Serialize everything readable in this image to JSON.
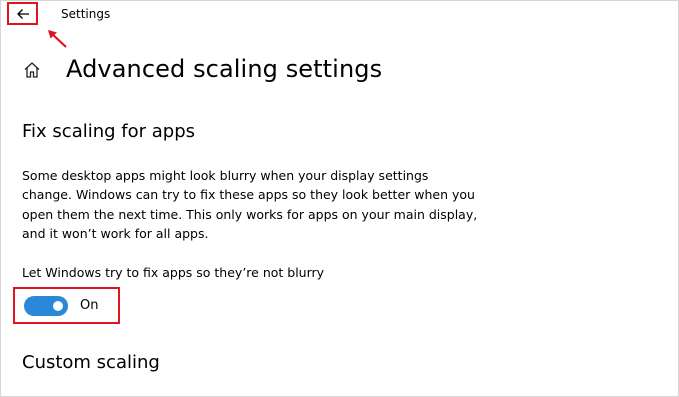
{
  "window": {
    "title": "Settings"
  },
  "page": {
    "title": "Advanced scaling settings"
  },
  "fix_scaling": {
    "heading": "Fix scaling for apps",
    "description": "Some desktop apps might look blurry when your display settings change. Windows can try to fix these apps so they look better when you open them the next time. This only works for apps on your main display, and it won’t work for all apps.",
    "toggle_label": "Let Windows try to fix apps so they’re not blurry",
    "toggle_state": "On",
    "toggle_on": true
  },
  "custom_scaling": {
    "heading": "Custom scaling"
  },
  "icons": {
    "back": "back-arrow-icon",
    "home": "home-icon"
  },
  "colors": {
    "accent": "#2b88d8",
    "annotation": "#e0141e"
  }
}
